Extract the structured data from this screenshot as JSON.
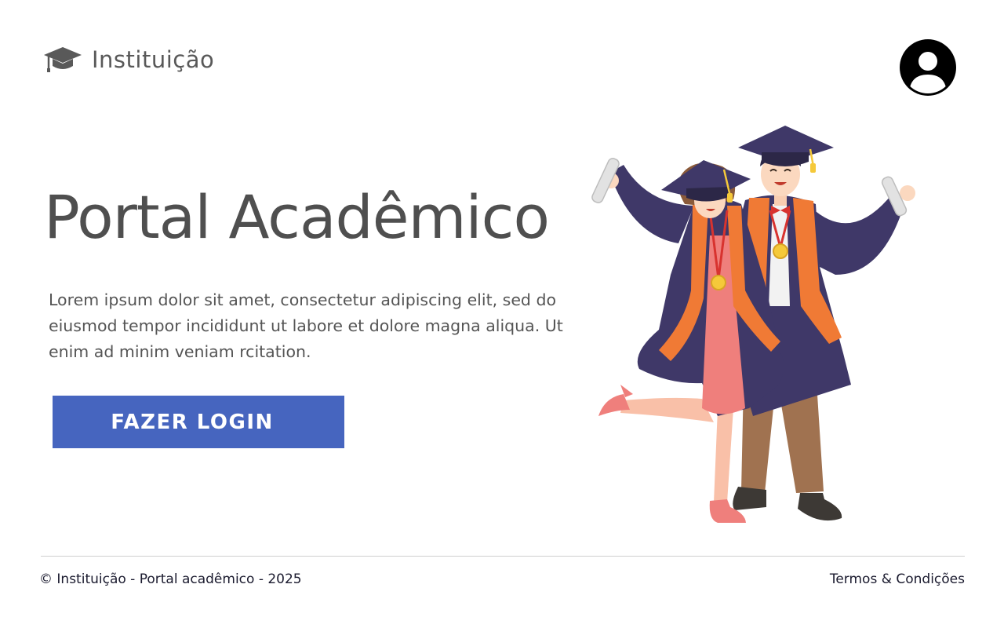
{
  "header": {
    "brand_name": "Instituição",
    "brand_icon": "graduation-cap-icon",
    "avatar_icon": "user-avatar-icon"
  },
  "hero": {
    "title": "Portal Acadêmico",
    "description": "Lorem ipsum dolor sit amet, consectetur adipiscing elit, sed do eiusmod tempor incididunt ut labore et dolore magna aliqua. Ut enim ad minim veniam rcitation.",
    "login_label": "FAZER LOGIN",
    "illustration": "graduates-celebrating-illustration"
  },
  "footer": {
    "copyright": "© Instituição - Portal acadêmico - 2025",
    "terms_label": "Termos & Condições"
  },
  "colors": {
    "primary_button": "#4665bf",
    "title_text": "#4f4f4f",
    "body_text": "#555555",
    "footer_text": "#1a1a2e",
    "gown": "#3f3868",
    "stole": "#f07a35",
    "dress": "#ef7f7c"
  }
}
